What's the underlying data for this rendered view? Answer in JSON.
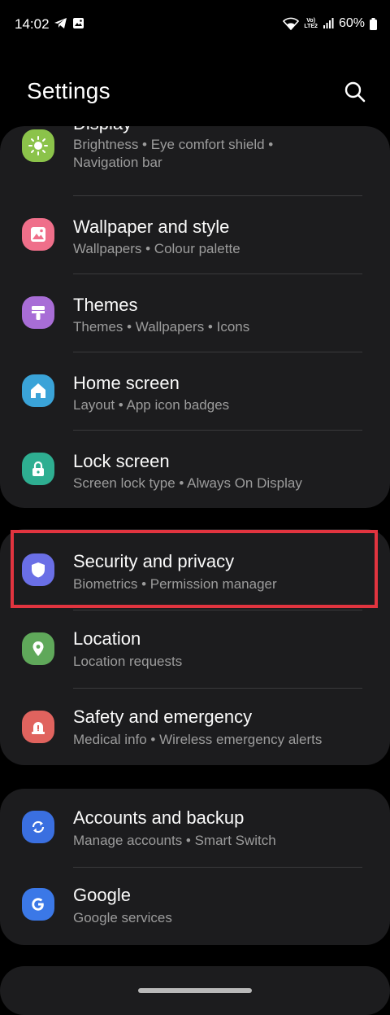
{
  "status_bar": {
    "time": "14:02",
    "battery": "60%",
    "network_label": "VoLTE2"
  },
  "header": {
    "title": "Settings"
  },
  "groups": [
    {
      "items": [
        {
          "title": "Display",
          "subtitle": "Brightness  •  Eye comfort shield  •",
          "subtitle2": "Navigation bar",
          "icon": "sun-icon",
          "color": "#8bc34a"
        },
        {
          "title": "Wallpaper and style",
          "subtitle": "Wallpapers  •  Colour palette",
          "icon": "image-icon",
          "color": "#ef6f8a"
        },
        {
          "title": "Themes",
          "subtitle": "Themes  •  Wallpapers  •  Icons",
          "icon": "brush-icon",
          "color": "#a86dd6"
        },
        {
          "title": "Home screen",
          "subtitle": "Layout  •  App icon badges",
          "icon": "home-icon",
          "color": "#3aa3d8"
        },
        {
          "title": "Lock screen",
          "subtitle": "Screen lock type  •  Always On Display",
          "icon": "lock-icon",
          "color": "#2eae91"
        }
      ]
    },
    {
      "items": [
        {
          "title": "Security and privacy",
          "subtitle": "Biometrics  •  Permission manager",
          "icon": "shield-icon",
          "color": "#6a6fe6"
        },
        {
          "title": "Location",
          "subtitle": "Location requests",
          "icon": "location-pin-icon",
          "color": "#5fa85a"
        },
        {
          "title": "Safety and emergency",
          "subtitle": "Medical info  •  Wireless emergency alerts",
          "icon": "alert-icon",
          "color": "#e0635e"
        }
      ]
    },
    {
      "items": [
        {
          "title": "Accounts and backup",
          "subtitle": "Manage accounts  •  Smart Switch",
          "icon": "sync-icon",
          "color": "#3a6fe0"
        },
        {
          "title": "Google",
          "subtitle": "Google services",
          "icon": "google-icon",
          "color": "#3b78e7"
        }
      ]
    }
  ],
  "highlight_color": "#e1343f"
}
